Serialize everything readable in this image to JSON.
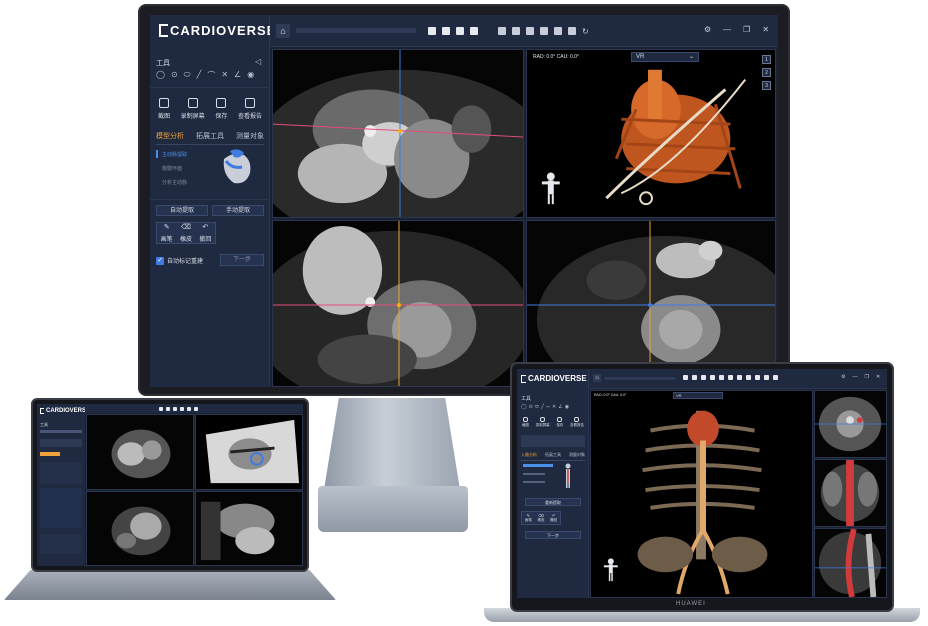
{
  "app": {
    "logo_text": "CARDIOVERSE"
  },
  "monitor": {
    "sidebar": {
      "tools_title": "工具",
      "actions": [
        "截图",
        "录制屏幕",
        "保存",
        "查看报告"
      ],
      "tabs": [
        "模型分析",
        "拓展工具",
        "测量对象"
      ],
      "list": [
        "主动脉提取",
        "瓣膜环面",
        "分析主动脉"
      ],
      "btn_auto": "自动提取",
      "btn_manual": "手动提取",
      "mini_actions": [
        "画笔",
        "橡皮",
        "撤回"
      ],
      "checkbox_label": "自动标记重建",
      "next_btn": "下一步"
    },
    "viewport_3d": {
      "angle_text": "RAD: 0.0°  CAU: 0.0°",
      "mode_select": "VR",
      "layout_numbers": [
        "1",
        "2",
        "3"
      ]
    }
  },
  "laptop": {
    "logo_text": "CARDIOVERSE",
    "sidebar": {
      "tools_title": "工具"
    }
  },
  "notebook": {
    "logo_text": "CARDIOVERSE",
    "sidebar": {
      "tools_title": "工具",
      "actions": [
        "截图",
        "录制屏幕",
        "保存",
        "查看报告"
      ],
      "tabs": [
        "入路分析",
        "拓展工具",
        "测量对象"
      ],
      "btn_auto": "重新提取",
      "mini_actions": [
        "画笔",
        "橡皮",
        "撤回"
      ],
      "next_btn": "下一步"
    },
    "viewport_3d": {
      "angle_text": "RAO: 0.0°  CAU: 0.0°",
      "mode_select": "VR"
    },
    "brand": "HUAWEI"
  },
  "colors": {
    "accent_orange": "#f0a23b",
    "accent_blue": "#4a8fe8",
    "panel": "#1f2a40"
  }
}
